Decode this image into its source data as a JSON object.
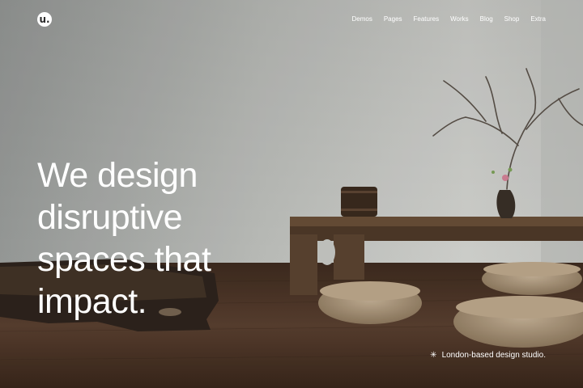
{
  "header": {
    "logo_text": "u.",
    "nav": [
      "Demos",
      "Pages",
      "Features",
      "Works",
      "Blog",
      "Shop",
      "Extra"
    ]
  },
  "hero": {
    "headline": [
      "We design",
      "disruptive",
      "spaces that",
      "impact."
    ],
    "tagline": "London-based design studio.",
    "tagline_icon": "asterisk-icon"
  },
  "colors": {
    "text": "#ffffff",
    "wall": "#c9cac6",
    "floor": "#4a3526"
  }
}
